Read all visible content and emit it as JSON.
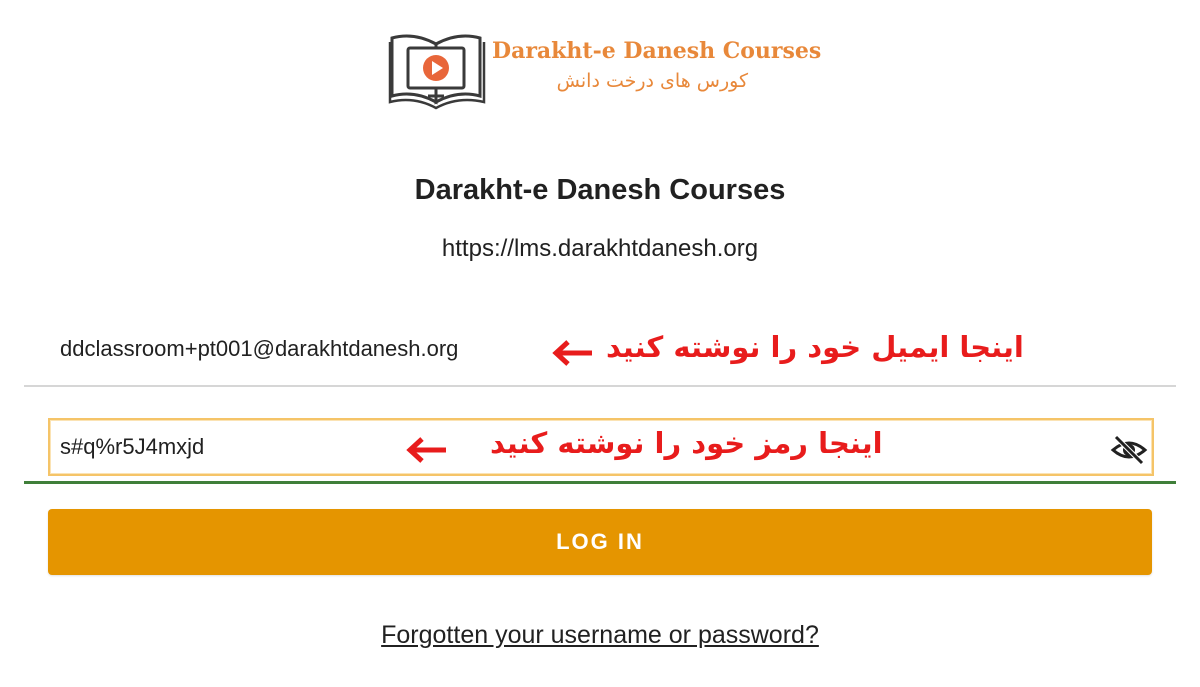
{
  "logo": {
    "name_en": "Darakht-e Danesh Courses",
    "name_fa": "کورس های درخت دانش",
    "icon": "book-play-icon"
  },
  "site": {
    "title": "Darakht-e Danesh Courses",
    "url": "https://lms.darakhtdanesh.org"
  },
  "login": {
    "email_value": "ddclassroom+pt001@darakhtdanesh.org",
    "email_annotation": "اینجا ایمیل خود را نوشته کنید",
    "password_value": "s#q%r5J4mxjd",
    "password_annotation": "اینجا رمز خود را نوشته کنید",
    "toggle_icon": "eye-slash-icon",
    "button_label": "LOG IN",
    "forgot_link": "Forgotten your username or password?"
  },
  "colors": {
    "brand_orange": "#e8883a",
    "button": "#e59500",
    "annotation_red": "#e81c1c",
    "focus_underline": "#3f7f3a",
    "focus_box": "#f5c468"
  }
}
